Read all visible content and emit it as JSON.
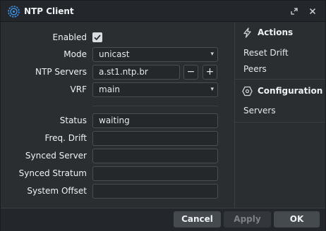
{
  "window": {
    "title": "NTP Client"
  },
  "form": {
    "enabled": {
      "label": "Enabled",
      "checked": true
    },
    "mode": {
      "label": "Mode",
      "value": "unicast"
    },
    "ntp_servers": {
      "label": "NTP Servers",
      "value": "a.st1.ntp.br",
      "remove_label": "−",
      "add_label": "+"
    },
    "vrf": {
      "label": "VRF",
      "value": "main"
    },
    "status": {
      "label": "Status",
      "value": "waiting"
    },
    "freq_drift": {
      "label": "Freq. Drift",
      "value": ""
    },
    "synced_server": {
      "label": "Synced Server",
      "value": ""
    },
    "synced_stratum": {
      "label": "Synced Stratum",
      "value": ""
    },
    "system_offset": {
      "label": "System Offset",
      "value": ""
    }
  },
  "sidebar": {
    "actions": {
      "title": "Actions",
      "items": [
        "Reset Drift",
        "Peers"
      ]
    },
    "configuration": {
      "title": "Configuration",
      "items": [
        "Servers"
      ]
    }
  },
  "footer": {
    "cancel": "Cancel",
    "apply": "Apply",
    "ok": "OK"
  },
  "icons": {
    "title": "gear-settings-icon",
    "restore": "restore-window-icon",
    "close": "close-icon",
    "actions": "lightning-icon",
    "configuration": "hexagon-icon",
    "dropdown": "chevron-down-icon",
    "checkbox": "check-icon"
  },
  "colors": {
    "accent": "#3d8fe0",
    "background": "#2b2e31",
    "titlebar": "#23262a"
  }
}
